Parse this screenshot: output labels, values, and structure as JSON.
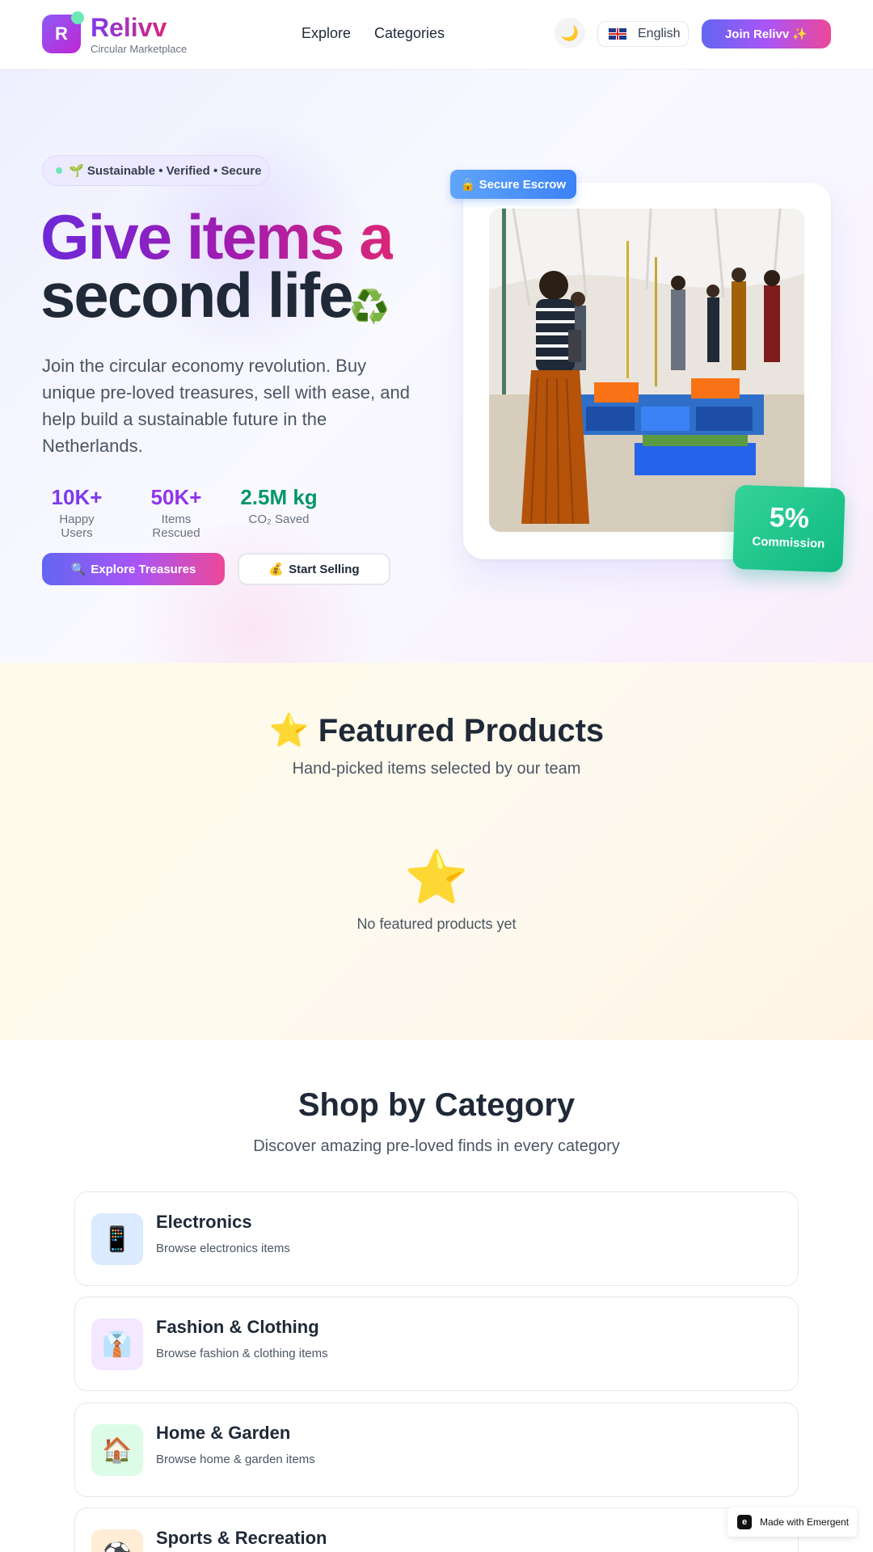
{
  "header": {
    "logo_letter": "R",
    "brand": "Relivv",
    "brand_sub": "Circular Marketplace",
    "nav": [
      "Explore",
      "Categories"
    ],
    "language": "English",
    "join": "Join Relivv ✨"
  },
  "hero": {
    "pill": "🌱 Sustainable • Verified • Secure",
    "title_line1": "Give items a",
    "title_line2": "second life",
    "title_emoji": "♻️",
    "description": "Join the circular economy revolution. Buy unique pre-loved treasures, sell with ease, and help build a sustainable future in the Netherlands.",
    "stats": [
      {
        "value": "10K+",
        "label": "Happy Users",
        "color": "#7c3aed"
      },
      {
        "value": "50K+",
        "label": "Items Rescued",
        "color": "#9333ea"
      },
      {
        "value": "2.5M kg",
        "label": "CO₂ Saved",
        "color": "#059669"
      }
    ],
    "explore_btn": "Explore Treasures",
    "explore_icon": "🔍",
    "sell_btn": "Start Selling",
    "sell_icon": "💰",
    "escrow_icon": "🔒",
    "escrow_badge": "Secure Escrow",
    "commission_value": "5%",
    "commission_label": "Commission"
  },
  "featured": {
    "title": "⭐ Featured Products",
    "subtitle": "Hand-picked items selected by our team",
    "empty_icon": "⭐",
    "empty_text": "No featured products yet"
  },
  "categories": {
    "title": "Shop by Category",
    "subtitle": "Discover amazing pre-loved finds in every category",
    "items": [
      {
        "icon": "📱",
        "name": "Electronics",
        "desc": "Browse electronics items",
        "bg": "#dbeafe"
      },
      {
        "icon": "👔",
        "name": "Fashion & Clothing",
        "desc": "Browse fashion & clothing items",
        "bg": "#f3e8ff"
      },
      {
        "icon": "🏠",
        "name": "Home & Garden",
        "desc": "Browse home & garden items",
        "bg": "#dcfce7"
      },
      {
        "icon": "⚽",
        "name": "Sports & Recreation",
        "desc": "",
        "bg": "#ffedd5"
      }
    ]
  },
  "badge": {
    "icon_letter": "e",
    "label": "Made with Emergent"
  },
  "colors": {
    "primary": "#7c3aed",
    "accent_pink": "#ec4899",
    "accent_green": "#10b981",
    "escrow_blue": "#3b82f6"
  }
}
